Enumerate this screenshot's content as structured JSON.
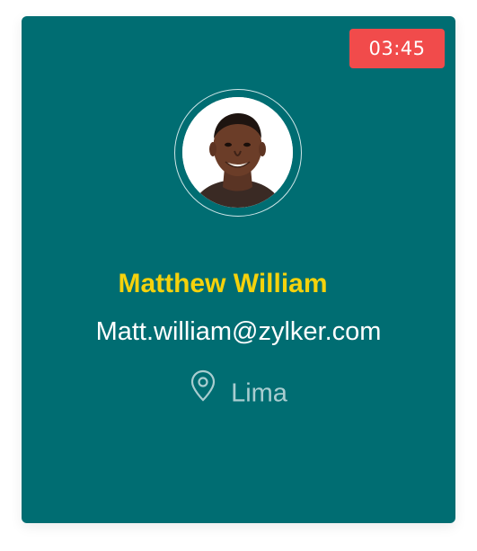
{
  "card": {
    "timer": "03:45",
    "name": "Matthew William",
    "email": "Matt.william@zylker.com",
    "location": "Lima",
    "icons": {
      "avatar": "profile-photo",
      "location": "location-pin-icon"
    },
    "colors": {
      "background": "#006d72",
      "timer": "#f14b4b",
      "name": "#f5d20c",
      "email": "#ffffff",
      "location": "#a9cdd0"
    }
  }
}
